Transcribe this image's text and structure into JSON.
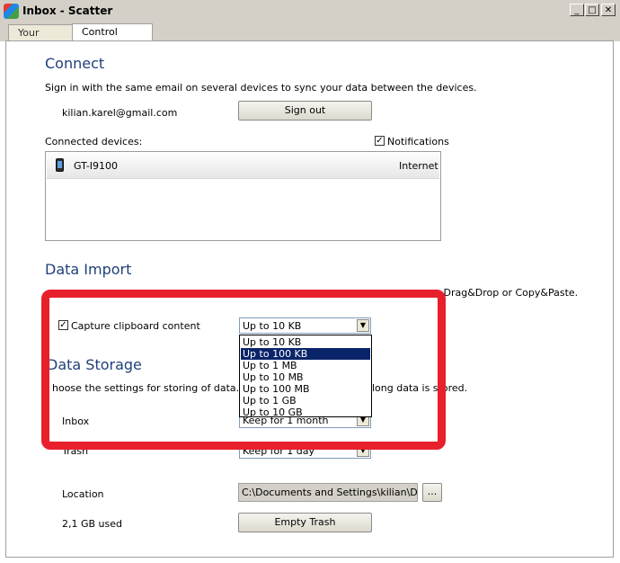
{
  "window": {
    "title": "Inbox - Scatter",
    "minimize_glyph": "_",
    "maximize_glyph": "□",
    "close_glyph": "✕"
  },
  "tabs": [
    {
      "label": "Your Data",
      "active": false
    },
    {
      "label": "Control Panel",
      "active": true
    }
  ],
  "connect": {
    "title": "Connect",
    "description": "Sign in with the same email on several devices to sync your data between the devices.",
    "email": "kilian.karel@gmail.com",
    "sign_out_label": "Sign out",
    "connected_devices_label": "Connected devices:",
    "notifications_label": "Notifications",
    "notifications_checked": true,
    "devices": [
      {
        "name": "GT-I9100",
        "connection": "Internet",
        "icon": "phone-icon"
      }
    ]
  },
  "data_import": {
    "title": "Data Import",
    "description_partial": "g Drag&Drop or Copy&Paste.",
    "capture_label": "Capture clipboard content",
    "capture_checked": true,
    "size_limit_value": "Up to 10 KB",
    "size_limit_options": [
      "Up to 10 KB",
      "Up to 100 KB",
      "Up to 1 MB",
      "Up to 10 MB",
      "Up to 100 MB",
      "Up to 1 GB",
      "Up to 10 GB"
    ],
    "highlighted_option": "Up to 100 KB"
  },
  "data_storage": {
    "title": "Data Storage",
    "description_left": "hoose the settings for storing of data. You c",
    "description_right": "long data is stored.",
    "inbox_label": "Inbox",
    "inbox_value": "Keep for 1 month",
    "trash_label": "Trash",
    "trash_value": "Keep for 1 day",
    "location_label": "Location",
    "location_value": "C:\\Documents and Settings\\kilian\\Dokum",
    "browse_label": "...",
    "used_label": "2,1 GB used",
    "empty_trash_label": "Empty Trash"
  },
  "colors": {
    "section_title": "#1f3f7a",
    "highlight_frame": "#e8202b",
    "selection": "#0a246a"
  }
}
